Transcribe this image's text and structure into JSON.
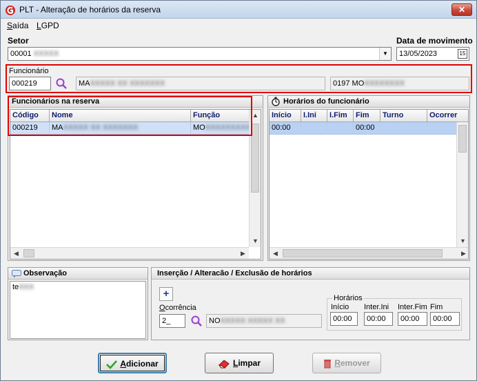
{
  "window": {
    "title": "PLT - Alteração de horários da reserva",
    "close_glyph": "✕"
  },
  "menu": {
    "items": [
      {
        "accel": "S",
        "rest": "aída"
      },
      {
        "accel": "L",
        "rest": "GPD"
      }
    ]
  },
  "setor": {
    "label": "Setor",
    "value": "00001",
    "value_redacted": "XXXXX"
  },
  "data_movimento": {
    "label": "Data de movimento",
    "value": "13/05/2023",
    "calendar_glyph": "15"
  },
  "funcionario": {
    "label": "Funcionário",
    "code": "000219",
    "name_prefix": "MA",
    "name_redacted": "XXXXX XX XXXXXXX",
    "func_prefix": "0197 MO",
    "func_redacted": "XXXXXXXX"
  },
  "reserva_panel": {
    "title": "Funcionários na reserva",
    "columns": [
      "Código",
      "Nome",
      "Função"
    ],
    "rows": [
      {
        "codigo": "000219",
        "nome_prefix": "MA",
        "nome_redacted": "XXXXX XX XXXXXXX",
        "funcao_prefix": "MO",
        "funcao_redacted": "XXXXXXXXX"
      }
    ]
  },
  "horarios_panel": {
    "title": "Horários do funcionário",
    "columns": [
      "Início",
      "I.Ini",
      "I.Fim",
      "Fim",
      "Turno",
      "Ocorrer"
    ],
    "rows": [
      {
        "inicio": "00:00",
        "iini": "",
        "ifim": "",
        "fim": "00:00",
        "turno": "",
        "ocorrer": ""
      }
    ]
  },
  "observacao": {
    "title": "Observação",
    "text_prefix": "te",
    "text_redacted": "XXX"
  },
  "insercao": {
    "title": "Inserção / Alteracão / Exclusão de horários",
    "add_glyph": "+",
    "ocorrencia_label_accel": "O",
    "ocorrencia_label_rest": "corrência",
    "ocorrencia_value": "2_",
    "ocorrencia_desc_prefix": "NO",
    "ocorrencia_desc_redacted": "XXXXX XXXXX XX",
    "horarios_group": "Horários",
    "fields": [
      {
        "label": "Início",
        "value": "00:00"
      },
      {
        "label": "Inter.Ini",
        "value": "00:00"
      },
      {
        "label": "Inter.Fim",
        "value": "00:00"
      },
      {
        "label": "Fim",
        "value": "00:00"
      }
    ]
  },
  "buttons": {
    "adicionar": {
      "accel": "A",
      "rest": "dicionar"
    },
    "limpar": {
      "accel": "L",
      "rest": "impar"
    },
    "remover": {
      "accel": "R",
      "rest": "emover"
    }
  },
  "colors": {
    "highlight_red": "#e00000",
    "selection": "#cfe0f7",
    "header_text": "#0e1a6e"
  }
}
